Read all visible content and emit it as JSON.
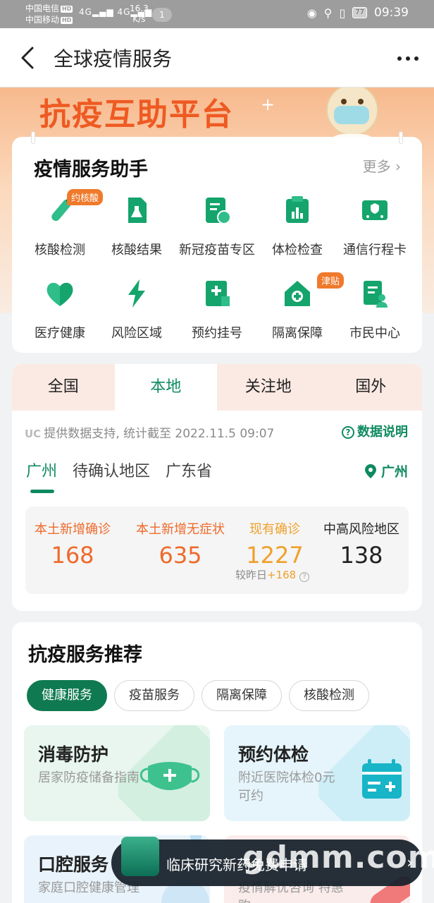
{
  "status_bar": {
    "carrier1": "中国电信",
    "carrier2": "中国移动",
    "hd": "HD",
    "signal1": "4G",
    "signal2": "4G",
    "speed_value": "16.3",
    "speed_unit": "K/s",
    "notification_count": "1",
    "battery": "77",
    "time": "09:39"
  },
  "header": {
    "title": "全球疫情服务"
  },
  "banner": {
    "text": "抗疫互助平台"
  },
  "helper": {
    "title": "疫情服务助手",
    "more": "更多",
    "items": [
      {
        "label": "核酸检测",
        "badge": "约核酸",
        "icon": "test-tube-icon"
      },
      {
        "label": "核酸结果",
        "icon": "result-flask-icon"
      },
      {
        "label": "新冠疫苗专区",
        "icon": "vaccine-doc-icon"
      },
      {
        "label": "体检检查",
        "icon": "chart-clipboard-icon"
      },
      {
        "label": "通信行程卡",
        "icon": "travel-card-icon"
      },
      {
        "label": "医疗健康",
        "icon": "heart-icon"
      },
      {
        "label": "风险区域",
        "icon": "lightning-icon"
      },
      {
        "label": "预约挂号",
        "icon": "appointment-icon"
      },
      {
        "label": "隔离保障",
        "badge": "津贴",
        "icon": "house-plus-icon"
      },
      {
        "label": "市民中心",
        "icon": "citizen-icon"
      }
    ]
  },
  "data_card": {
    "tabs": [
      "全国",
      "本地",
      "关注地",
      "国外"
    ],
    "active_tab": "本地",
    "source_logo": "UC",
    "source": "提供数据支持, 统计截至 2022.11.5 09:07",
    "explain": "数据说明",
    "region_tabs": [
      "广州",
      "待确认地区",
      "广东省"
    ],
    "location": "广州",
    "stats": [
      {
        "label": "本土新增确诊",
        "value": "168",
        "color": "#ef6a2b"
      },
      {
        "label": "本土新增无症状",
        "value": "635",
        "color": "#ef6a2b"
      },
      {
        "label": "现有确诊",
        "value": "1227",
        "color": "#f0a02b"
      },
      {
        "label": "中高风险地区",
        "value": "138",
        "color": "#222222"
      }
    ],
    "compare_label": "较昨日",
    "compare_delta": "+168"
  },
  "recommend": {
    "title": "抗疫服务推荐",
    "chips": [
      "健康服务",
      "疫苗服务",
      "隔离保障",
      "核酸检测"
    ],
    "active_chip": "健康服务",
    "cards": [
      {
        "title": "消毒防护",
        "subtitle": "居家防疫储备指南",
        "icon": "mask-icon"
      },
      {
        "title": "预约体检",
        "subtitle": "附近医院体检0元可约",
        "icon": "calendar-plus-icon"
      },
      {
        "title": "口腔服务",
        "subtitle": "家庭口腔健康管理",
        "icon": "tooth-icon"
      },
      {
        "title": "",
        "subtitle": "疫情解忧咨询 特惠购",
        "icon": "pill-icon"
      }
    ]
  },
  "floating_banner": {
    "text": "临床研究新药免费申请"
  },
  "watermark": "gdmm.com"
}
